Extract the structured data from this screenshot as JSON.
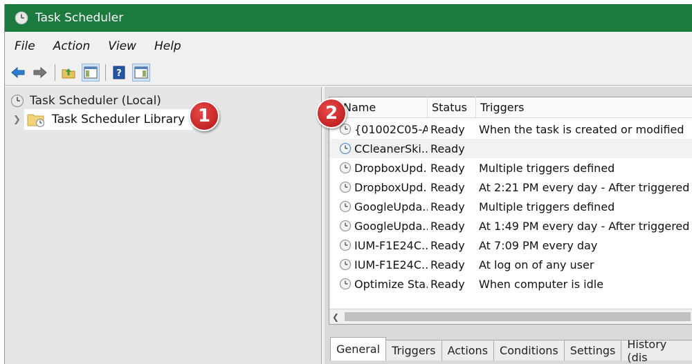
{
  "window": {
    "title": "Task Scheduler",
    "accent": "#1c7a3e"
  },
  "menu": [
    "File",
    "Action",
    "View",
    "Help"
  ],
  "toolbar": {
    "buttons": [
      "back-arrow-icon",
      "forward-arrow-icon",
      "up-folder-icon",
      "show-hide-console-tree-icon",
      "help-icon",
      "show-action-pane-icon"
    ]
  },
  "tree": {
    "root": "Task Scheduler (Local)",
    "library": "Task Scheduler Library",
    "badge1": "1"
  },
  "list": {
    "badge2": "2",
    "columns": [
      "Name",
      "Status",
      "Triggers"
    ],
    "rows": [
      {
        "name": "{01002C05-A...",
        "status": "Ready",
        "trigger": "When the task is created or modified"
      },
      {
        "name": "CCleanerSki...",
        "status": "Ready",
        "trigger": ""
      },
      {
        "name": "DropboxUpd...",
        "status": "Ready",
        "trigger": "Multiple triggers defined"
      },
      {
        "name": "DropboxUpd...",
        "status": "Ready",
        "trigger": "At 2:21 PM every day - After triggered"
      },
      {
        "name": "GoogleUpda...",
        "status": "Ready",
        "trigger": "Multiple triggers defined"
      },
      {
        "name": "GoogleUpda...",
        "status": "Ready",
        "trigger": "At 1:49 PM every day - After triggered"
      },
      {
        "name": "IUM-F1E24C...",
        "status": "Ready",
        "trigger": "At 7:09 PM every day"
      },
      {
        "name": "IUM-F1E24C...",
        "status": "Ready",
        "trigger": "At log on of any user"
      },
      {
        "name": "Optimize Sta...",
        "status": "Ready",
        "trigger": "When computer is idle"
      }
    ],
    "selected_index": 1
  },
  "tabs": [
    "General",
    "Triggers",
    "Actions",
    "Conditions",
    "Settings",
    "History (dis"
  ]
}
